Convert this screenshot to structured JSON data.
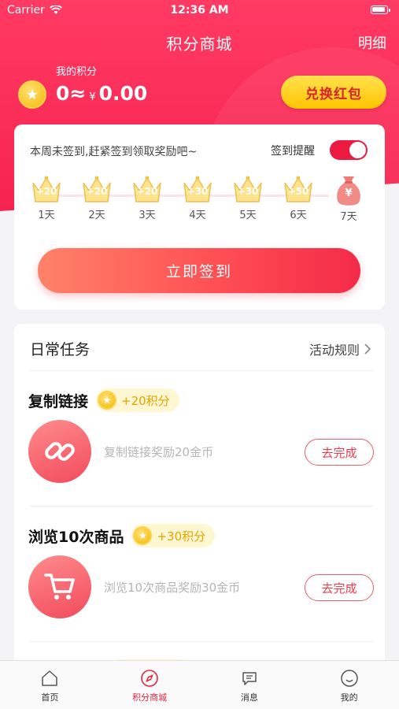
{
  "status_bar": {
    "carrier": "Carrier",
    "time": "12:36 AM"
  },
  "nav": {
    "title": "积分商城",
    "right_action": "明细"
  },
  "points": {
    "label": "我的积分",
    "value": "0≈",
    "currency": "¥",
    "amount": "0.00",
    "redeem_button": "兑换红包"
  },
  "checkin": {
    "tip": "本周未签到,赶紧签到领取奖励吧~",
    "remind_label": "签到提醒",
    "remind_on": true,
    "days": [
      {
        "bonus": "+20",
        "label": "1天"
      },
      {
        "bonus": "+20",
        "label": "2天"
      },
      {
        "bonus": "+20",
        "label": "3天"
      },
      {
        "bonus": "+30",
        "label": "4天"
      },
      {
        "bonus": "+30",
        "label": "5天"
      },
      {
        "bonus": "+50",
        "label": "6天"
      },
      {
        "bonus": "¥",
        "label": "7天"
      }
    ],
    "signin_button": "立即签到"
  },
  "tasks": {
    "title": "日常任务",
    "rules_link": "活动规则",
    "items": [
      {
        "title": "复制链接",
        "points": "+20积分",
        "desc": "复制链接奖励20金币",
        "action": "去完成",
        "icon": "link-icon"
      },
      {
        "title": "浏览10次商品",
        "points": "+30积分",
        "desc": "浏览10次商品奖励30金币",
        "action": "去完成",
        "icon": "cart-icon"
      }
    ]
  },
  "tabbar": {
    "items": [
      {
        "label": "首页",
        "icon": "home-icon"
      },
      {
        "label": "积分商城",
        "icon": "compass-icon",
        "active": true
      },
      {
        "label": "消息",
        "icon": "message-icon"
      },
      {
        "label": "我的",
        "icon": "profile-icon"
      }
    ]
  },
  "colors": {
    "brand": "#f5204e",
    "gold": "#ffc400",
    "bg": "#f4f4f6"
  }
}
